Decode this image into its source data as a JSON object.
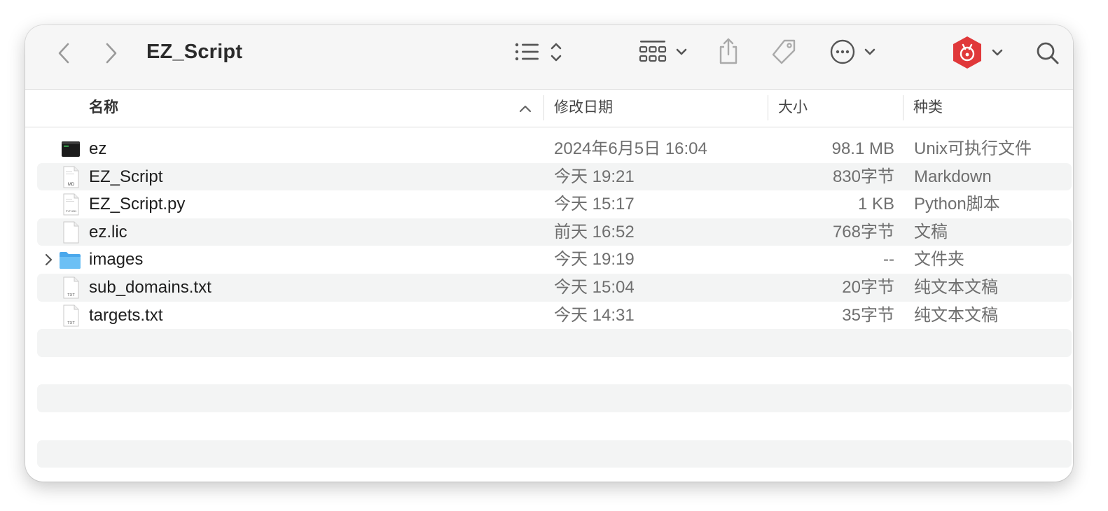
{
  "window": {
    "title": "EZ_Script"
  },
  "toolbar": {
    "icons": [
      "back-icon",
      "forward-icon",
      "list-view-icon",
      "group-icon",
      "share-icon",
      "tag-icon",
      "more-icon",
      "app-extension-icon",
      "search-icon"
    ]
  },
  "columns": {
    "name": "名称",
    "date": "修改日期",
    "size": "大小",
    "kind": "种类",
    "sort": "ascending"
  },
  "files": [
    {
      "name": "ez",
      "date": "2024年6月5日 16:04",
      "size": "98.1 MB",
      "kind": "Unix可执行文件",
      "icon": "executable-icon"
    },
    {
      "name": "EZ_Script",
      "date": "今天 19:21",
      "size": "830字节",
      "kind": "Markdown",
      "icon": "markdown-file-icon",
      "badge": "MD"
    },
    {
      "name": "EZ_Script.py",
      "date": "今天 15:17",
      "size": "1 KB",
      "kind": "Python脚本",
      "icon": "python-file-icon",
      "badge": "PYTHON"
    },
    {
      "name": "ez.lic",
      "date": "前天 16:52",
      "size": "768字节",
      "kind": "文稿",
      "icon": "document-icon"
    },
    {
      "name": "images",
      "date": "今天 19:19",
      "size": "--",
      "kind": "文件夹",
      "icon": "folder-icon"
    },
    {
      "name": "sub_domains.txt",
      "date": "今天 15:04",
      "size": "20字节",
      "kind": "纯文本文稿",
      "icon": "text-file-icon",
      "badge": "TXT"
    },
    {
      "name": "targets.txt",
      "date": "今天 14:31",
      "size": "35字节",
      "kind": "纯文本文稿",
      "icon": "text-file-icon",
      "badge": "TXT"
    }
  ],
  "colors": {
    "accent_red": "#e0383a",
    "folder_blue": "#5db3ef",
    "row_alt": "#f3f4f4"
  }
}
